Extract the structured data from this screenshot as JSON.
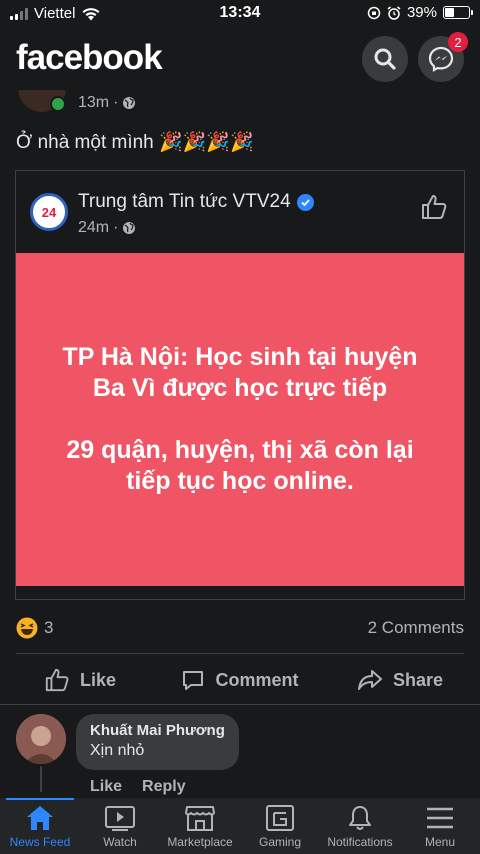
{
  "status": {
    "carrier": "Viettel",
    "time": "13:34",
    "battery_percent": "39%",
    "battery_level": 0.39
  },
  "header": {
    "logo": "facebook",
    "messenger_badge": "2"
  },
  "post": {
    "time": "13m",
    "text": "Ở nhà một mình 🎉🎉🎉🎉"
  },
  "shared": {
    "page_name": "Trung tâm Tin tức VTV24",
    "avatar_text": "24",
    "time": "24m",
    "headline_line1": "TP Hà Nội: Học sinh tại huyện Ba Vì được học trực tiếp",
    "headline_line2": "29 quận, huyện, thị xã còn lại tiếp tục học online."
  },
  "reactions": {
    "count": "3",
    "comments": "2 Comments"
  },
  "actions": {
    "like": "Like",
    "comment": "Comment",
    "share": "Share"
  },
  "comment": {
    "author": "Khuất Mai Phương",
    "text": "Xịn nhỏ",
    "like": "Like",
    "reply": "Reply"
  },
  "nav": {
    "items": [
      {
        "label": "News Feed",
        "icon": "home-icon"
      },
      {
        "label": "Watch",
        "icon": "watch-icon"
      },
      {
        "label": "Marketplace",
        "icon": "marketplace-icon"
      },
      {
        "label": "Gaming",
        "icon": "gaming-icon"
      },
      {
        "label": "Notifications",
        "icon": "bell-icon"
      },
      {
        "label": "Menu",
        "icon": "menu-icon"
      }
    ]
  },
  "colors": {
    "accent": "#2d88ff",
    "headline_bg": "#f05565",
    "background": "#18191a"
  }
}
